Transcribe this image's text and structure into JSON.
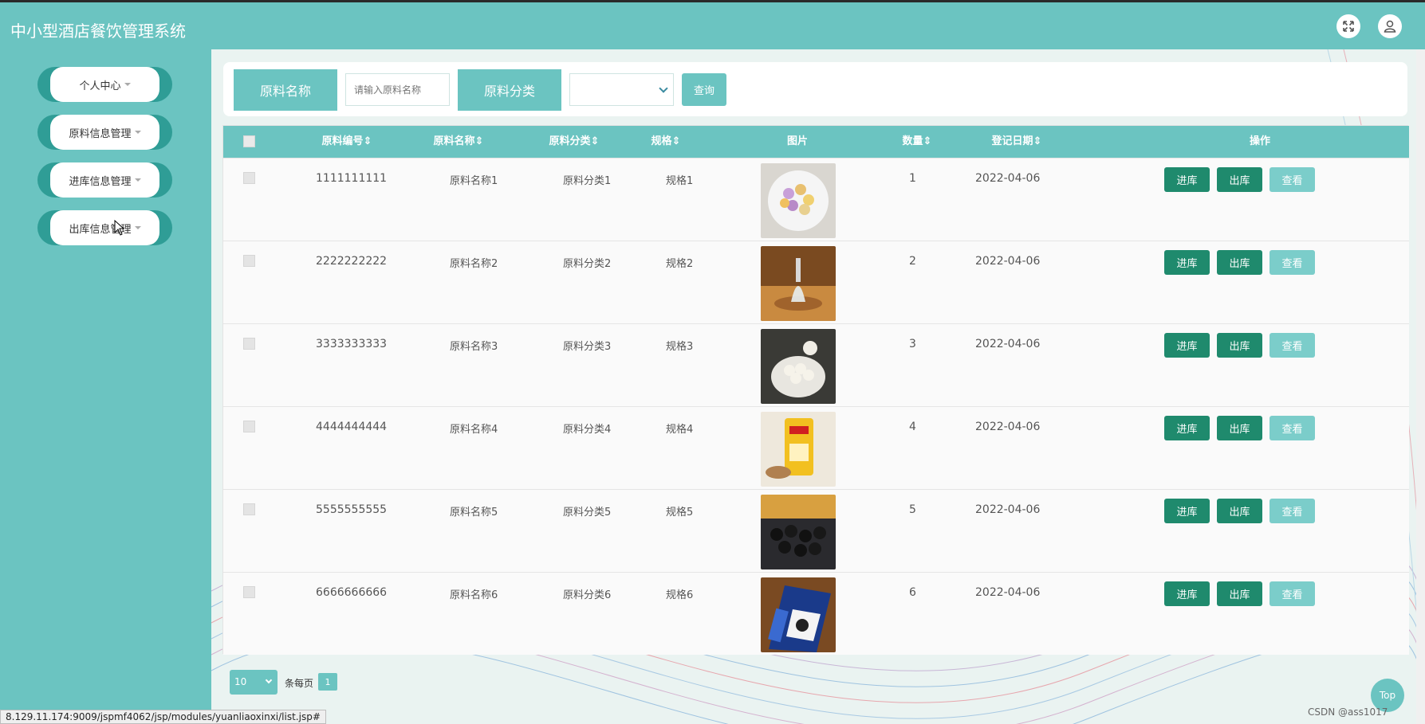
{
  "app": {
    "title": "中小型酒店餐饮管理系统"
  },
  "header": {
    "fullscreen_icon": "expand-icon",
    "user_icon": "user-icon"
  },
  "sidebar": {
    "items": [
      {
        "label": "个人中心"
      },
      {
        "label": "原料信息管理"
      },
      {
        "label": "进库信息管理"
      },
      {
        "label": "出库信息管理"
      }
    ]
  },
  "search": {
    "name_label": "原料名称",
    "name_placeholder": "请输入原料名称",
    "category_label": "原料分类",
    "category_value": "",
    "query_button": "查询"
  },
  "table": {
    "columns": [
      "原料编号",
      "原料名称",
      "原料分类",
      "规格",
      "图片",
      "数量",
      "登记日期",
      "操作"
    ],
    "rows": [
      {
        "code": "1111111111",
        "name": "原料名称1",
        "category": "原料分类1",
        "spec": "规格1",
        "qty": "1",
        "date": "2022-04-06"
      },
      {
        "code": "2222222222",
        "name": "原料名称2",
        "category": "原料分类2",
        "spec": "规格2",
        "qty": "2",
        "date": "2022-04-06"
      },
      {
        "code": "3333333333",
        "name": "原料名称3",
        "category": "原料分类3",
        "spec": "规格3",
        "qty": "3",
        "date": "2022-04-06"
      },
      {
        "code": "4444444444",
        "name": "原料名称4",
        "category": "原料分类4",
        "spec": "规格4",
        "qty": "4",
        "date": "2022-04-06"
      },
      {
        "code": "5555555555",
        "name": "原料名称5",
        "category": "原料分类5",
        "spec": "规格5",
        "qty": "5",
        "date": "2022-04-06"
      },
      {
        "code": "6666666666",
        "name": "原料名称6",
        "category": "原料分类6",
        "spec": "规格6",
        "qty": "6",
        "date": "2022-04-06"
      }
    ],
    "actions": {
      "in": "进库",
      "out": "出库",
      "view": "查看"
    }
  },
  "pagination": {
    "page_size": "10",
    "per_page_label": "条每页",
    "current_page": "1"
  },
  "status_url": "8.129.11.174:9009/jspmf4062/jsp/modules/yuanliaoxinxi/list.jsp#",
  "top_button": "Top",
  "watermark": "CSDN @ass1017",
  "colors": {
    "primary": "#6bc4c1",
    "dark_button": "#1f8a6d",
    "light_button": "#7bcdca"
  }
}
